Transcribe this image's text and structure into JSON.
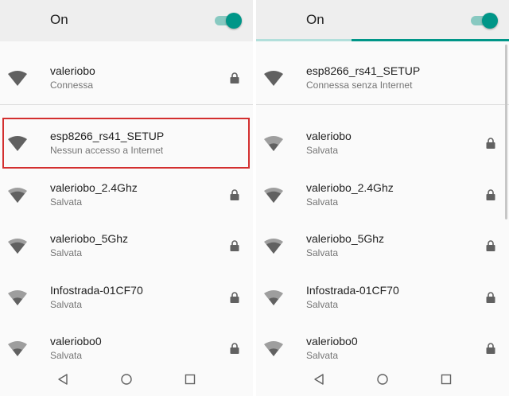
{
  "colors": {
    "accent": "#009688",
    "highlight_border": "#d32f2f",
    "wifi_strong": "#616161",
    "wifi_weak": "#9e9e9e"
  },
  "left": {
    "header": {
      "label": "On",
      "toggle_on": true
    },
    "networks": [
      {
        "ssid": "valeriobo",
        "status": "Connessa",
        "icon": "wifi-signal-icon",
        "locked": true
      },
      {
        "ssid": "esp8266_rs41_SETUP",
        "status": "Nessun accesso a Internet",
        "icon": "wifi-signal-icon",
        "locked": false
      },
      {
        "ssid": "valeriobo_2.4Ghz",
        "status": "Salvata",
        "icon": "wifi-signal-icon",
        "locked": true
      },
      {
        "ssid": "valeriobo_5Ghz",
        "status": "Salvata",
        "icon": "wifi-signal-icon",
        "locked": true
      },
      {
        "ssid": "Infostrada-01CF70",
        "status": "Salvata",
        "icon": "wifi-signal-icon",
        "locked": true
      },
      {
        "ssid": "valeriobo0",
        "status": "Salvata",
        "icon": "wifi-signal-icon",
        "locked": true
      }
    ]
  },
  "right": {
    "header": {
      "label": "On",
      "toggle_on": true
    },
    "networks": [
      {
        "ssid": "esp8266_rs41_SETUP",
        "status": "Connessa senza Internet",
        "icon": "wifi-signal-icon",
        "locked": false
      },
      {
        "ssid": "valeriobo",
        "status": "Salvata",
        "icon": "wifi-signal-icon",
        "locked": true
      },
      {
        "ssid": "valeriobo_2.4Ghz",
        "status": "Salvata",
        "icon": "wifi-signal-icon",
        "locked": true
      },
      {
        "ssid": "valeriobo_5Ghz",
        "status": "Salvata",
        "icon": "wifi-signal-icon",
        "locked": true
      },
      {
        "ssid": "Infostrada-01CF70",
        "status": "Salvata",
        "icon": "wifi-signal-icon",
        "locked": true
      },
      {
        "ssid": "valeriobo0",
        "status": "Salvata",
        "icon": "wifi-signal-icon",
        "locked": true
      }
    ]
  },
  "navbar": {
    "buttons": [
      "back-icon",
      "home-icon",
      "recents-icon"
    ]
  }
}
